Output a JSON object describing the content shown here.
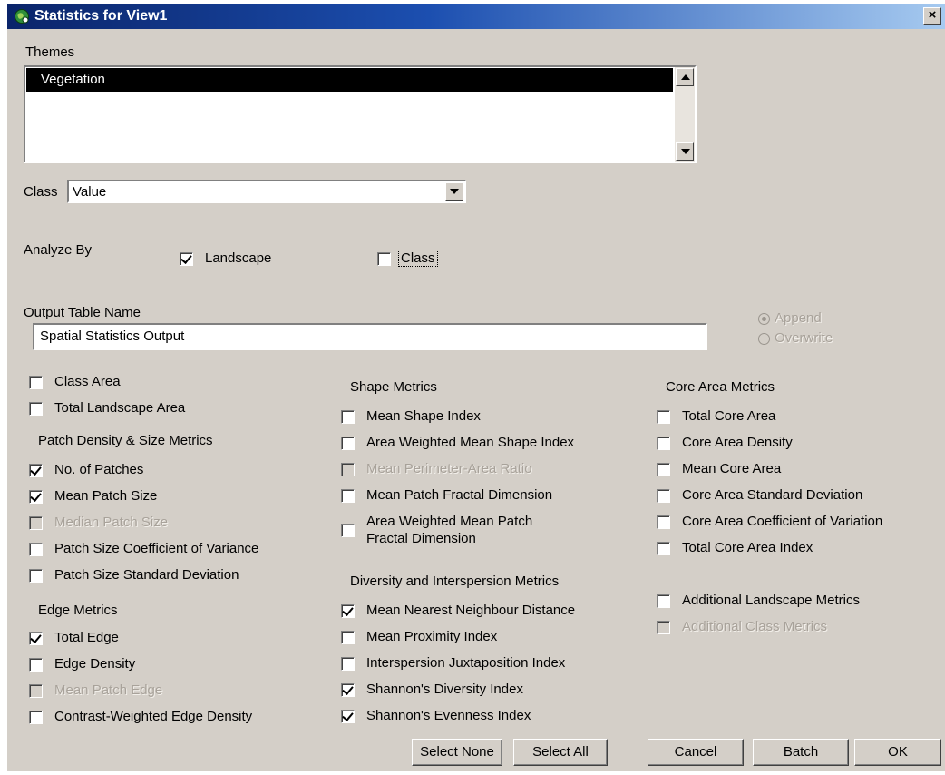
{
  "window": {
    "title": "Statistics for View1",
    "close_glyph": "×"
  },
  "themes": {
    "label": "Themes",
    "items": [
      "Vegetation"
    ]
  },
  "class_field": {
    "label": "Class",
    "value": "Value"
  },
  "analyze_by": {
    "label": "Analyze By",
    "landscape": "Landscape",
    "class": "Class"
  },
  "output": {
    "label": "Output Table Name",
    "value": "Spatial Statistics Output",
    "append": "Append",
    "overwrite": "Overwrite"
  },
  "col1": {
    "class_area": "Class Area",
    "total_landscape_area": "Total Landscape Area",
    "patch_header": "Patch Density & Size Metrics",
    "no_of_patches": "No. of Patches",
    "mean_patch_size": "Mean Patch Size",
    "median_patch_size": "Median Patch Size",
    "patch_size_cov": "Patch Size Coefficient of Variance",
    "patch_size_sd": "Patch Size Standard Deviation",
    "edge_header": "Edge Metrics",
    "total_edge": "Total Edge",
    "edge_density": "Edge Density",
    "mean_patch_edge": "Mean Patch Edge",
    "contrast_edge_density": "Contrast-Weighted Edge Density"
  },
  "col2": {
    "shape_header": "Shape Metrics",
    "mean_shape_index": "Mean Shape Index",
    "awm_shape_index": "Area Weighted Mean Shape Index",
    "mean_perimeter_area": "Mean Perimeter-Area Ratio",
    "mean_patch_fractal": "Mean Patch Fractal Dimension",
    "awm_patch_fractal_1": "Area Weighted Mean Patch",
    "awm_patch_fractal_2": "Fractal Dimension",
    "diversity_header": "Diversity and Interspersion Metrics",
    "mean_nn_distance": "Mean Nearest Neighbour Distance",
    "mean_proximity": "Mean Proximity Index",
    "interspersion": "Interspersion Juxtaposition Index",
    "shannon_diversity": "Shannon's Diversity Index",
    "shannon_evenness": "Shannon's Evenness Index"
  },
  "col3": {
    "core_header": "Core Area Metrics",
    "total_core_area": "Total Core Area",
    "core_area_density": "Core Area Density",
    "mean_core_area": "Mean Core Area",
    "core_area_sd": "Core Area Standard Deviation",
    "core_area_cov": "Core Area Coefficient of Variation",
    "total_core_area_index": "Total Core Area Index",
    "additional_landscape": "Additional Landscape Metrics",
    "additional_class": "Additional Class Metrics"
  },
  "buttons": {
    "select_none": "Select None",
    "select_all": "Select All",
    "cancel": "Cancel",
    "batch": "Batch",
    "ok": "OK"
  }
}
